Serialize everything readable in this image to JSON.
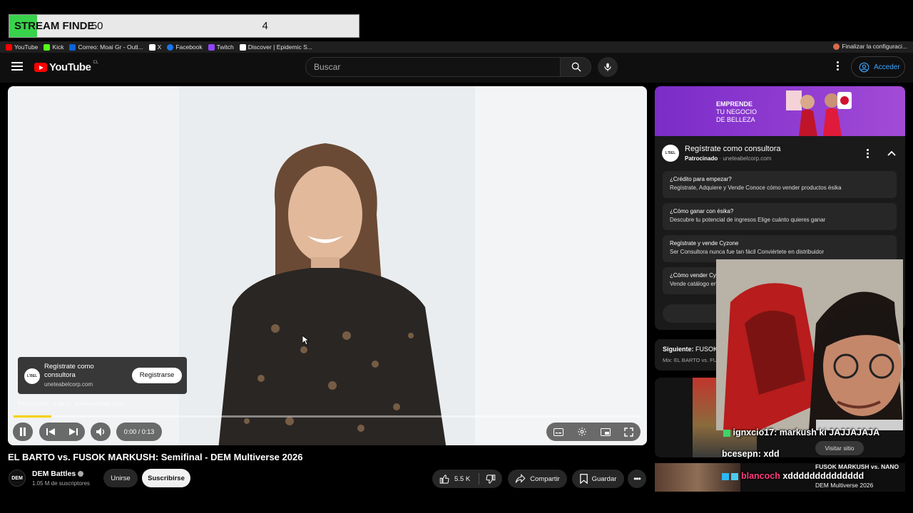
{
  "stream_overlay": {
    "title": "STREAM FINDE",
    "count": "4",
    "goal": "50",
    "progress_fraction": 0.08
  },
  "bookmarks": [
    {
      "label": "YouTube",
      "icon": "youtube-icon",
      "color": "#ff0000"
    },
    {
      "label": "Kick",
      "icon": "kick-icon",
      "color": "#53fc18"
    },
    {
      "label": "Correo: Moai Gr - Outl...",
      "icon": "outlook-icon",
      "color": "#0a64d6"
    },
    {
      "label": "X",
      "icon": "x-icon",
      "color": "#ffffff"
    },
    {
      "label": "Facebook",
      "icon": "facebook-icon",
      "color": "#1877f2"
    },
    {
      "label": "Twitch",
      "icon": "twitch-icon",
      "color": "#9146ff"
    },
    {
      "label": "Discover | Epidemic S...",
      "icon": "epidemic-icon",
      "color": "#ffffff"
    }
  ],
  "bookmark_right": "Finalizar la configuraci...",
  "header": {
    "logo_text": "YouTube",
    "country": "CL",
    "search_placeholder": "Buscar",
    "login_label": "Acceder"
  },
  "player": {
    "ad_card": {
      "title": "Regístrate como consultora",
      "domain": "uneteabelcorp.com",
      "cta": "Registrarse",
      "logo": "L'BEL"
    },
    "ad_info": "Patrocinado · 1 de 2 · uneteabelcorp.com",
    "time": "0:00 / 0:13",
    "progress_fraction": 0.06,
    "accent_color": "#f7d000"
  },
  "video": {
    "title": "EL BARTO vs. FUSOK MARKUSH: Semifinal - DEM Multiverse 2026",
    "channel": "DEM Battles",
    "channel_avatar": "DEM",
    "subscribers": "1.05 M de suscriptores",
    "join_label": "Unirse",
    "subscribe_label": "Suscribirse",
    "likes": "5.5 K",
    "share_label": "Compartir",
    "save_label": "Guardar"
  },
  "sidebar_ad": {
    "banner_line1": "EMPRENDE",
    "banner_line2": "TU NEGOCIO",
    "banner_line3": "DE BELLEZA",
    "title": "Regístrate como consultora",
    "sponsored": "Patrocinado",
    "domain": "uneteabelcorp.com",
    "logo": "L'BEL",
    "items": [
      {
        "q": "¿Crédito para empezar?",
        "a": "Regístrate, Adquiere y Vende Conoce cómo vender productos ésika"
      },
      {
        "q": "¿Cómo ganar con ésika?",
        "a": "Descubre tu potencial de ingresos Elige cuánto quieres ganar"
      },
      {
        "q": "Regístrate y vende Cyzone",
        "a": "Ser Consultora nunca fue tan fácil Conviértete en distribuidor"
      },
      {
        "q": "¿Cómo vender Cy",
        "a": "Vende catálogo en"
      }
    ]
  },
  "next": {
    "label": "Siguiente:",
    "title": "FUSOK",
    "sub": "Mix: EL BARTO vs. FU"
  },
  "chat": [
    {
      "user": "ignxcio17:",
      "msg": "markush ki JAJJAJAJA",
      "user_color": "#ffffff"
    },
    {
      "user": "bcesepn:",
      "msg": "xdd",
      "user_color": "#ffffff"
    },
    {
      "user": "blancoch",
      "msg": "xdddddddddddddd",
      "user_color": "#ff3b7d"
    }
  ],
  "recommendations": {
    "visit_label": "Visitar sitio",
    "rec2_title": "FUSOK MARKUSH vs. NANO",
    "rec2_sub": "DEM Multiverse 2026"
  }
}
